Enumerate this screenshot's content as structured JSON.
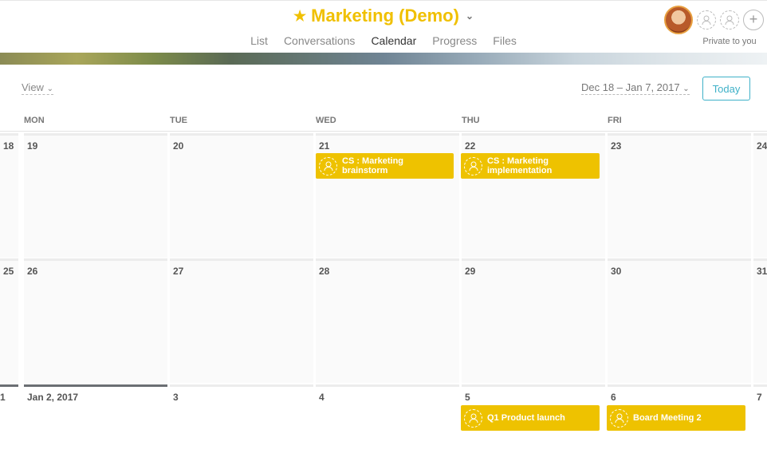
{
  "project": {
    "title": "Marketing (Demo)"
  },
  "tabs": [
    "List",
    "Conversations",
    "Calendar",
    "Progress",
    "Files"
  ],
  "privacy": "Private to you",
  "toolbar": {
    "view": "View",
    "range": "Dec 18 – Jan 7, 2017",
    "today": "Today"
  },
  "weekdays": [
    "MON",
    "TUE",
    "WED",
    "THU",
    "FRI"
  ],
  "weeks": [
    {
      "sun": "18",
      "days": [
        "19",
        "20",
        "21",
        "22",
        "23"
      ],
      "sat": "24"
    },
    {
      "sun": "25",
      "days": [
        "26",
        "27",
        "28",
        "29",
        "30"
      ],
      "sat": "31"
    },
    {
      "sun": "1",
      "days": [
        "Jan 2, 2017",
        "3",
        "4",
        "5",
        "6"
      ],
      "sat": "7"
    }
  ],
  "events": [
    {
      "title": "CS : Marketing brainstorm",
      "line1": "CS : Marketing",
      "line2": "brainstorm",
      "date": "21"
    },
    {
      "title": "CS : Marketing implementation",
      "line1": "CS : Marketing",
      "line2": "implementation",
      "date": "22"
    },
    {
      "title": "Q1 Product launch",
      "line1": "Q1 Product launch",
      "line2": "",
      "date": "5"
    },
    {
      "title": "Board Meeting 2",
      "line1": "Board Meeting 2",
      "line2": "",
      "date": "6"
    }
  ],
  "icons": [
    "star-icon",
    "chevron-down-icon",
    "user-placeholder-icon",
    "plus-icon"
  ],
  "colors": {
    "accent": "#f0c000",
    "event": "#eec200",
    "tab_underline": "#f06a6a",
    "today_button": "#3fb1c8"
  }
}
